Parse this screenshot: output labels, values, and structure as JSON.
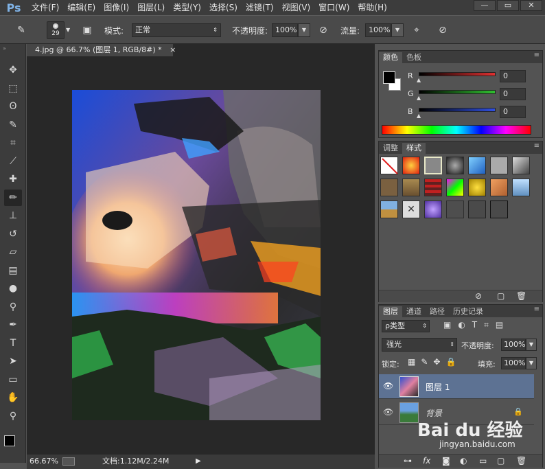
{
  "app": {
    "logo": "Ps"
  },
  "menu": [
    "文件(F)",
    "编辑(E)",
    "图像(I)",
    "图层(L)",
    "类型(Y)",
    "选择(S)",
    "滤镜(T)",
    "视图(V)",
    "窗口(W)",
    "帮助(H)"
  ],
  "window_controls": [
    "—",
    "▭",
    "✕"
  ],
  "options": {
    "brush_size": "29",
    "mode_label": "模式:",
    "mode_value": "正常",
    "opacity_label": "不透明度:",
    "opacity_value": "100%",
    "flow_label": "流量:",
    "flow_value": "100%"
  },
  "tools": [
    "move-tool",
    "marquee-tool",
    "lasso-tool",
    "quick-select-tool",
    "crop-tool",
    "eyedropper-tool",
    "healing-tool",
    "brush-tool",
    "stamp-tool",
    "history-brush-tool",
    "eraser-tool",
    "gradient-tool",
    "blur-tool",
    "dodge-tool",
    "pen-tool",
    "type-tool",
    "path-select-tool",
    "shape-tool",
    "hand-tool",
    "zoom-tool"
  ],
  "document": {
    "tab_title": "4.jpg @ 66.7% (图层 1, RGB/8#) *",
    "tab_close": "×"
  },
  "status": {
    "zoom": "66.67%",
    "doc_size": "文档:1.12M/2.24M"
  },
  "color_panel": {
    "tabs": [
      "颜色",
      "色板"
    ],
    "channels": [
      {
        "label": "R",
        "value": "0",
        "color": "#e03030"
      },
      {
        "label": "G",
        "value": "0",
        "color": "#30c030"
      },
      {
        "label": "B",
        "value": "0",
        "color": "#3050e0"
      }
    ]
  },
  "styles_panel": {
    "tabs": [
      "调整",
      "样式"
    ]
  },
  "layers_panel": {
    "tabs": [
      "图层",
      "通道",
      "路径",
      "历史记录"
    ],
    "filter_label": "ρ类型",
    "blend_mode": "强光",
    "opacity_label": "不透明度:",
    "opacity_value": "100%",
    "lock_label": "锁定:",
    "fill_label": "填充:",
    "fill_value": "100%",
    "layers": [
      {
        "name": "图层 1",
        "selected": true
      },
      {
        "name": "背景",
        "selected": false
      }
    ]
  },
  "watermark": {
    "text": "Bai du 经验",
    "sub": "jingyan.baidu.com"
  }
}
